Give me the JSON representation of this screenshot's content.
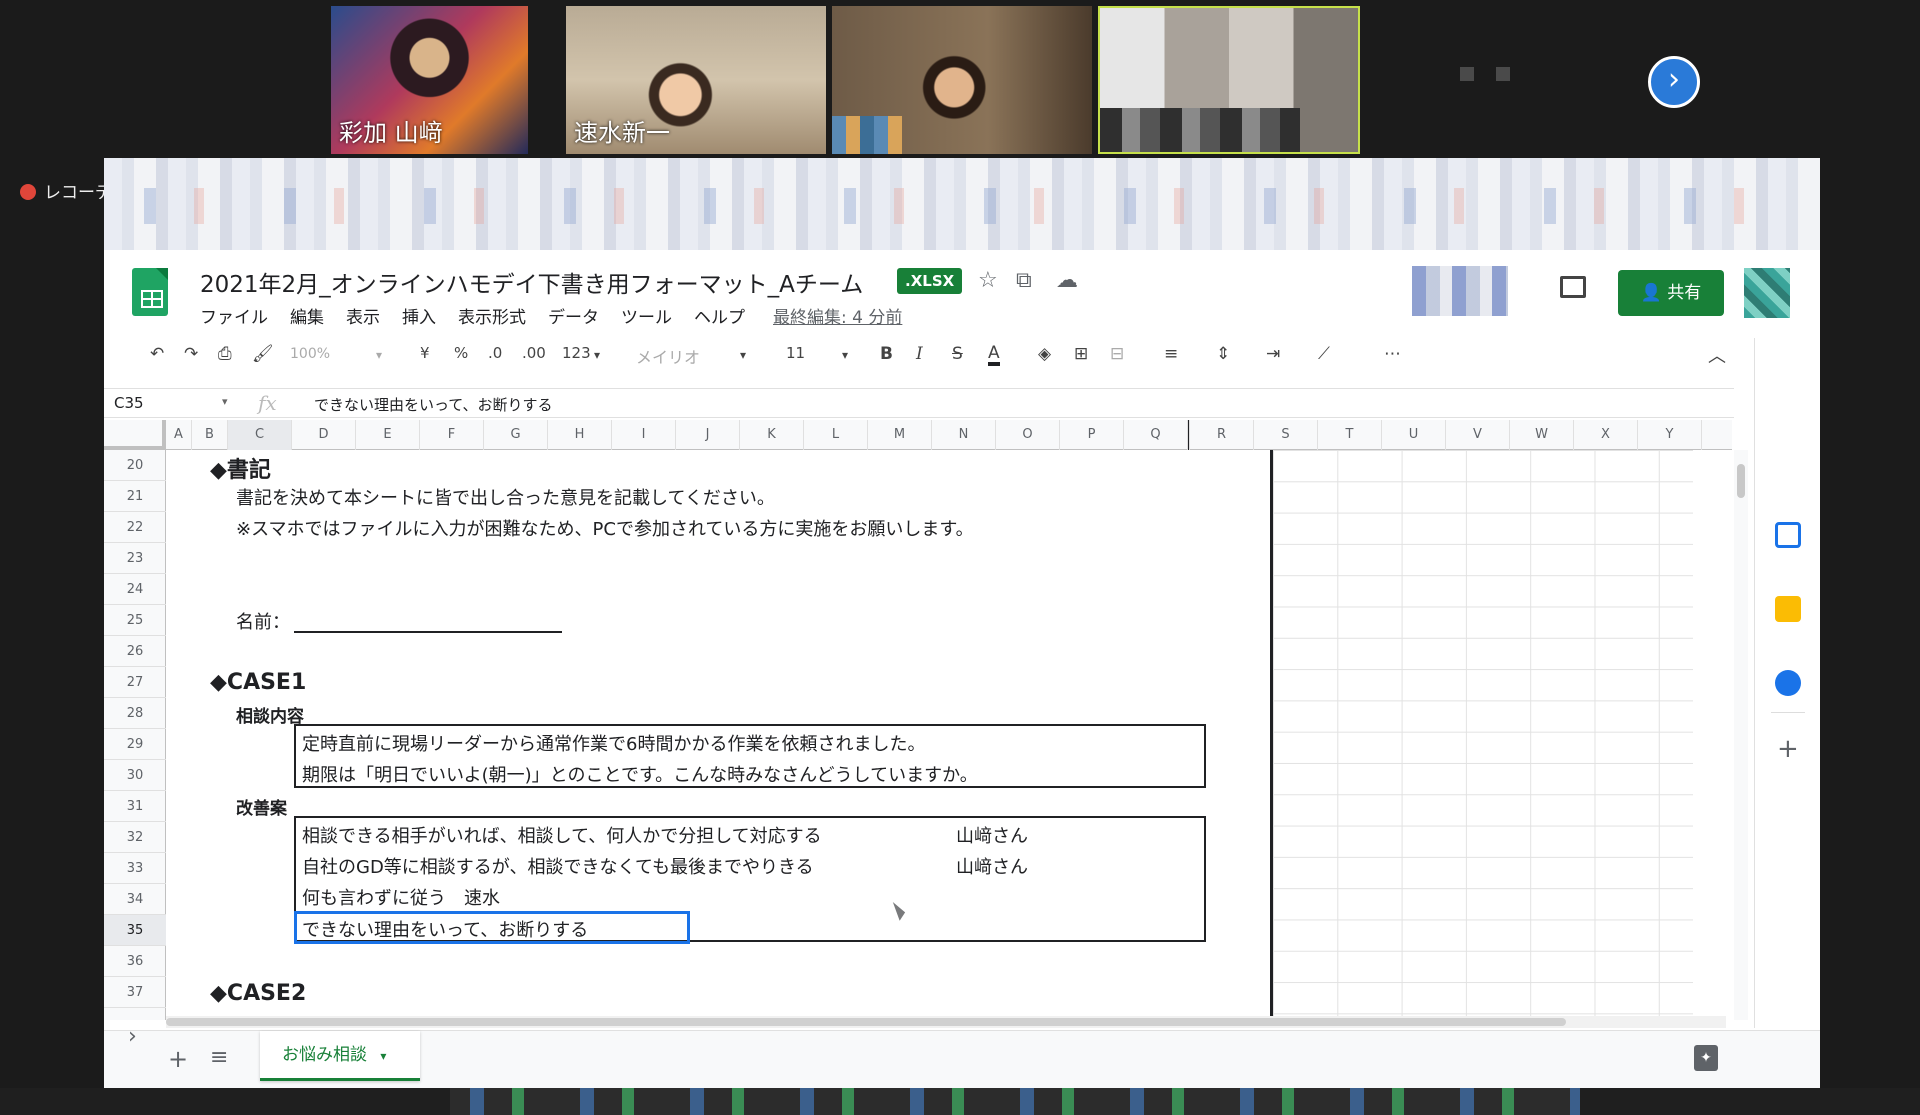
{
  "video": {
    "participants": [
      {
        "name": "彩加 山﨑"
      },
      {
        "name": "速水新一"
      },
      {
        "name": ""
      },
      {
        "name": ""
      }
    ],
    "next_icon": "chevron-right-icon"
  },
  "recording": {
    "label": "レコーデ"
  },
  "doc": {
    "title": "2021年2月_オンラインハモデイ下書き用フォーマット_Aチーム",
    "badge": ".XLSX",
    "menu": [
      "ファイル",
      "編集",
      "表示",
      "挿入",
      "表示形式",
      "データ",
      "ツール",
      "ヘルプ"
    ],
    "last_edit": "最終編集: 4 分前",
    "share_label": "共有"
  },
  "toolbar": {
    "zoom": "100%",
    "currency": "¥",
    "percent": "%",
    "dec_decrease": ".0",
    "dec_increase": ".00",
    "format_more": "123",
    "font": "メイリオ",
    "font_size": "11",
    "bold": "B",
    "italic": "I",
    "strike": "S",
    "text_color": "A",
    "more": "⋯"
  },
  "formula": {
    "cell_ref": "C35",
    "fx": "fx",
    "content": "できない理由をいって、お断りする"
  },
  "columns": [
    "A",
    "B",
    "C",
    "D",
    "E",
    "F",
    "G",
    "H",
    "I",
    "J",
    "K",
    "L",
    "M",
    "N",
    "O",
    "P",
    "Q",
    "R",
    "S",
    "T",
    "U",
    "V",
    "W",
    "X",
    "Y"
  ],
  "rows": [
    "20",
    "21",
    "22",
    "23",
    "24",
    "25",
    "26",
    "27",
    "28",
    "29",
    "30",
    "31",
    "32",
    "33",
    "34",
    "35",
    "36",
    "37"
  ],
  "sheet": {
    "section_record": "◆書記",
    "record_line1": "書記を決めて本シートに皆で出し合った意見を記載してください。",
    "record_line2": "※スマホではファイルに入力が困難なため、PCで参加されている方に実施をお願いします。",
    "name_label": "名前：",
    "case1": "◆CASE1",
    "consult_label": "相談内容",
    "consult_line1": "定時直前に現場リーダーから通常作業で6時間かかる作業を依頼されました。",
    "consult_line2": "期限は「明日でいいよ(朝一)」とのことです。こんな時みなさんどうしていますか。",
    "improve_label": "改善案",
    "ideas": [
      {
        "text": "相談できる相手がいれば、相談して、何人かで分担して対応する",
        "author": "山﨑さん"
      },
      {
        "text": "自社のGD等に相談するが、相談できなくても最後までやりきる",
        "author": "山﨑さん"
      },
      {
        "text": "何も言わずに従う　速水",
        "author": ""
      },
      {
        "text": "できない理由をいって、お断りする",
        "author": ""
      }
    ],
    "case2": "◆CASE2"
  },
  "tabs": {
    "active": "お悩み相談"
  },
  "colors": {
    "sheets_green": "#188038",
    "selection_blue": "#1a73e8",
    "recording_red": "#e0463a"
  }
}
